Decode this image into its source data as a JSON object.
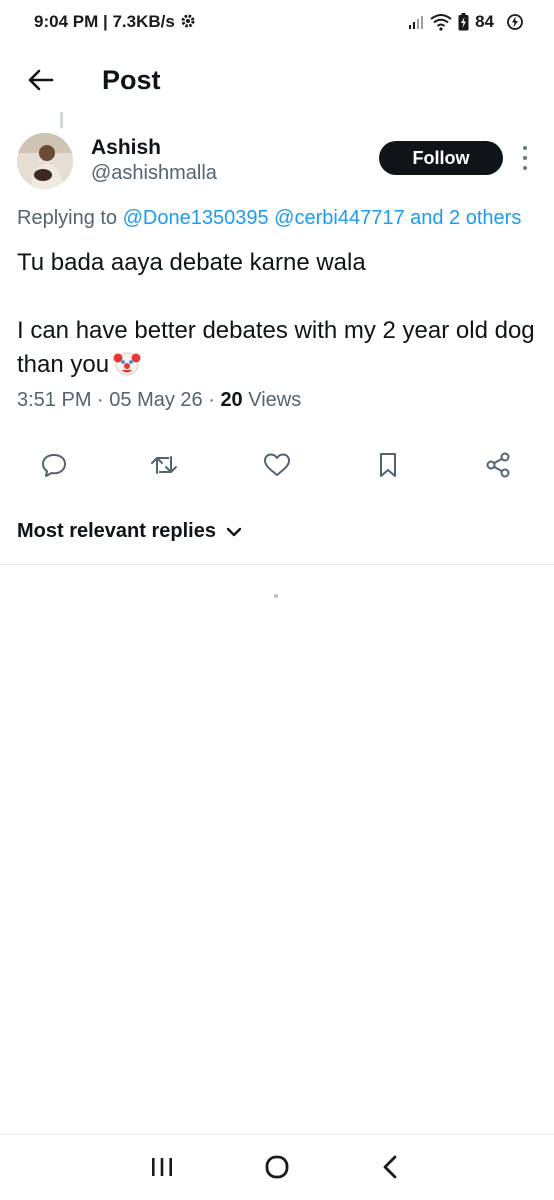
{
  "status_bar": {
    "time": "9:04 PM",
    "speed": "7.3KB/s",
    "battery": "84"
  },
  "header": {
    "title": "Post"
  },
  "post": {
    "author_name": "Ashish",
    "author_handle": "@ashishmalla",
    "follow_label": "Follow",
    "replying_prefix": "Replying to",
    "replying_to": [
      "@Done1350395",
      "@cerbi447717",
      "and 2 others"
    ],
    "text_line1": "Tu bada aaya debate karne wala",
    "text_line2": "I can have better debates with my 2 year old dog than you",
    "time": "3:51 PM",
    "date": "05 May 26",
    "views_count": "20",
    "views_label": "Views"
  },
  "replies": {
    "sort_label": "Most relevant replies"
  },
  "icons": {
    "back": "arrow-left-icon",
    "more": "more-vertical-icon",
    "reply": "comment-icon",
    "repost": "repost-icon",
    "like": "heart-icon",
    "bookmark": "bookmark-icon",
    "share": "share-icon",
    "emoji": "clown-face-emoji"
  },
  "colors": {
    "link": "#1d9bf0",
    "secondary_text": "#536471",
    "follow_bg": "#0f1419"
  }
}
